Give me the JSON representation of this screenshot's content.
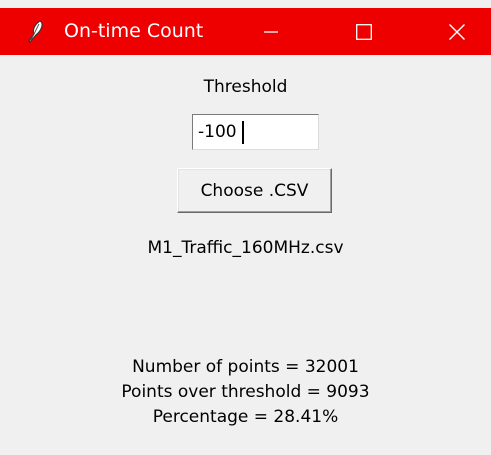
{
  "window": {
    "title": "On-time Count",
    "titlebar_color": "#ee0000",
    "icons": {
      "app": "feather-icon",
      "minimize": "minimize-icon",
      "maximize": "maximize-icon",
      "close": "close-icon"
    }
  },
  "threshold": {
    "label": "Threshold",
    "value": "-100"
  },
  "choose_button": {
    "label": "Choose .CSV"
  },
  "file": {
    "name": "M1_Traffic_160MHz.csv"
  },
  "results": {
    "points": "Number of points = 32001",
    "over_threshold": "Points over threshold = 9093",
    "percentage": "Percentage = 28.41%"
  }
}
